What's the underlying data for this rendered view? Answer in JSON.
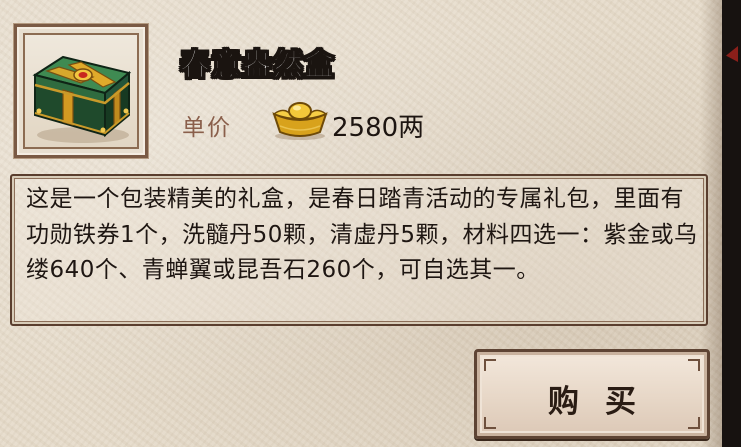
{
  "item": {
    "name": "春意盎然盒",
    "icon": "green-gift-box-icon"
  },
  "price": {
    "label": "单价",
    "currency_icon": "gold-ingot-icon",
    "value": "2580两"
  },
  "description": {
    "text": "这是一个包装精美的礼盒，是春日踏青活动的专属礼包，里面有功勋铁券1个，洗髓丹50颗，清虚丹5颗，材料四选一：紫金或乌缕640个、青蝉翼或昆吾石260个，可自选其一。"
  },
  "actions": {
    "buy_label": "购买"
  },
  "colors": {
    "parchment": "#e6dccb",
    "frame_border": "#5a3e2e",
    "price_label": "#8a5f4b",
    "gold": "#e8b820",
    "box_green": "#2f6b3f"
  }
}
